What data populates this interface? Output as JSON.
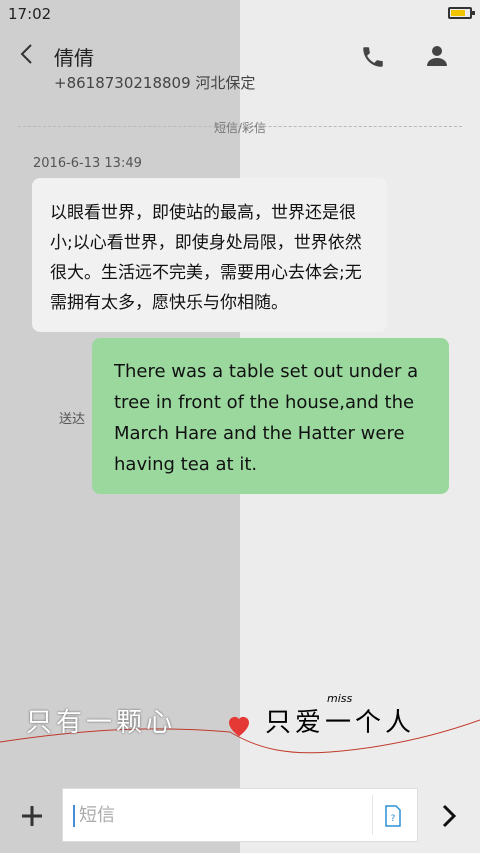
{
  "statusbar": {
    "time": "17:02"
  },
  "header": {
    "contact_name": "倩倩",
    "contact_number": "+8618730218809 河北保定"
  },
  "thread": {
    "divider_label": "短信/彩信",
    "timestamp": "2016-6-13 13:49",
    "incoming_text": "以眼看世界，即使站的最高，世界还是很小;以心看世界，即使身处局限，世界依然很大。生活远不完美，需要用心去体会;无需拥有太多，愿快乐与你相随。",
    "sent_status": "送达",
    "outgoing_text": "There was a table set out under a tree in front of the house,and the March Hare and the Hatter were having tea at it."
  },
  "wallpaper_art": {
    "left_text": "只有一颗心",
    "right_text": "只爱一个人",
    "small_text": "miss"
  },
  "composer": {
    "placeholder": "短信"
  },
  "icons": {
    "back": "back-arrow-icon",
    "phone": "phone-icon",
    "contact": "person-icon",
    "add": "plus-icon",
    "sim": "sim-card-icon",
    "send": "send-arrow-icon"
  },
  "colors": {
    "incoming_bubble": "#f1f1f1",
    "outgoing_bubble": "#9ad89e",
    "battery": "#f2c400"
  }
}
